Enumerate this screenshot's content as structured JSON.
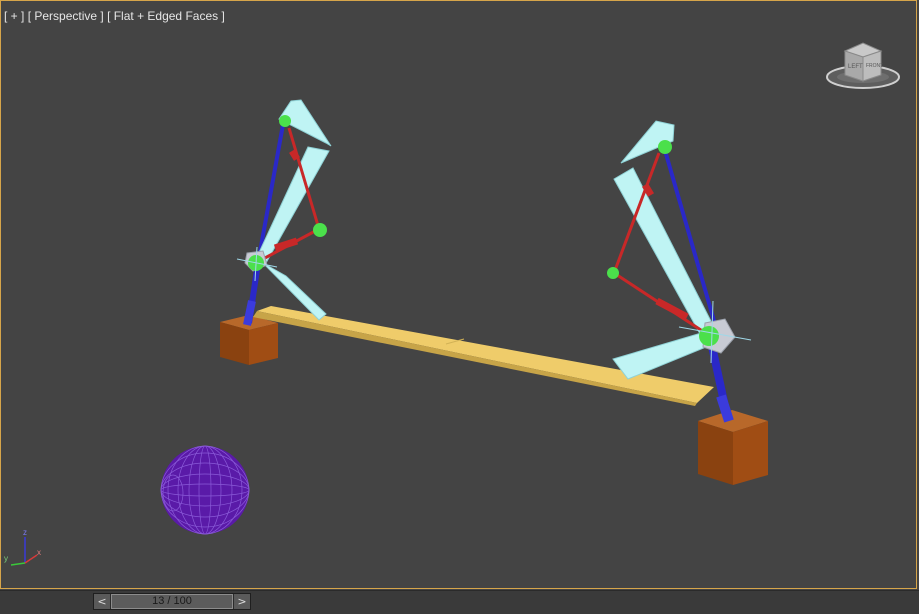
{
  "viewport": {
    "menu_label": "[ + ]",
    "view_label": "[ Perspective ]",
    "shading_label": "[ Flat + Edged Faces ]",
    "viewcube_face_left": "LEFT",
    "viewcube_face_front": "FRONT"
  },
  "axis_tripod": {
    "z": "z",
    "y": "y",
    "x": "x"
  },
  "time_slider": {
    "prev": "<",
    "next": ">",
    "frame_text": "13 / 100",
    "current_frame": 13,
    "total_frames": 100
  },
  "colors": {
    "viewport_bg": "#444444",
    "viewport_border": "#d6a54a",
    "bone_fill": "#bff4f4",
    "ik_chain": "#2a28c8",
    "ik_goal_link": "#c82828",
    "joint": "#4be04b",
    "board": "#efcc6a",
    "box": "#9a4a10",
    "sphere": "#5a1aa8"
  }
}
